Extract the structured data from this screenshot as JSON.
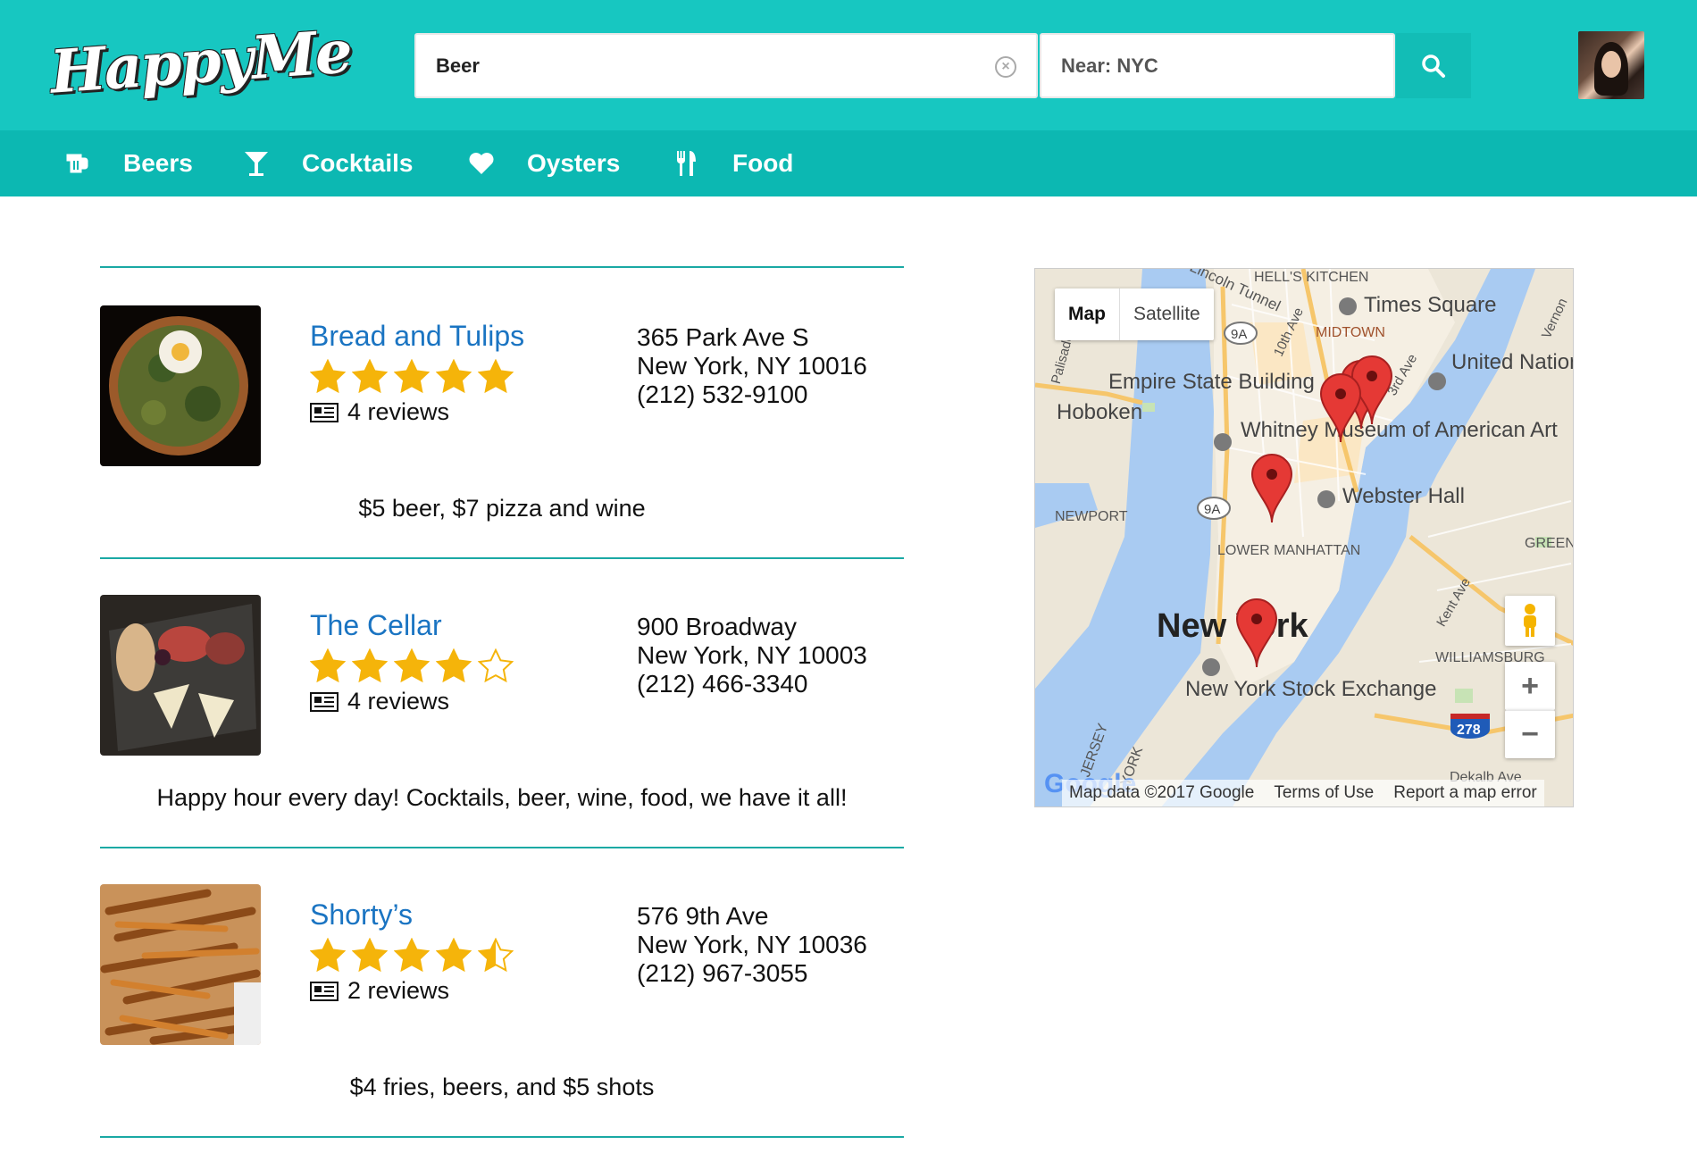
{
  "header": {
    "logo": "HappyMe",
    "search": {
      "value": "Beer"
    },
    "near": {
      "value": "Near: NYC"
    }
  },
  "nav": [
    {
      "label": "Beers",
      "icon": "beer-icon"
    },
    {
      "label": "Cocktails",
      "icon": "cocktail-icon"
    },
    {
      "label": "Oysters",
      "icon": "heart-icon"
    },
    {
      "label": "Food",
      "icon": "utensils-icon"
    }
  ],
  "results": [
    {
      "name": "Bread and Tulips",
      "rating": 5,
      "reviews": "4 reviews",
      "address1": "365 Park Ave S",
      "address2": "New York, NY 10016",
      "phone": "(212) 532-9100",
      "blurb": "$5 beer, $7 pizza and wine"
    },
    {
      "name": "The Cellar",
      "rating": 4,
      "reviews": "4 reviews",
      "address1": "900 Broadway",
      "address2": "New York, NY 10003",
      "phone": "(212) 466-3340",
      "blurb": "Happy hour every day! Cocktails, beer, wine, food, we have it all!"
    },
    {
      "name": "Shorty’s",
      "rating": 4.5,
      "reviews": "2 reviews",
      "address1": "576 9th Ave",
      "address2": "New York, NY 10036",
      "phone": "(212) 967-3055",
      "blurb": "$4 fries, beers, and $5 shots"
    }
  ],
  "map": {
    "type_buttons": [
      "Map",
      "Satellite"
    ],
    "labels": {
      "hells_kitchen": "HELL'S KITCHEN",
      "times_square": "Times Square",
      "midtown": "MIDTOWN",
      "united_nations": "United Nations Headquarters",
      "empire_state": "Empire State Building",
      "hoboken": "Hoboken",
      "whitney": "Whitney Museum of American Art",
      "webster_hall": "Webster Hall",
      "newport": "NEWPORT",
      "lower_manhattan": "LOWER MANHATTAN",
      "greenpoint": "GREEN",
      "new_york": "New York",
      "williamsburg": "WILLIAMSBURG",
      "stock_exchange": "New York Stock Exchange",
      "route_9a": "9A",
      "route_278": "278",
      "kent_ave": "Kent Ave",
      "third_ave": "3rd Ave",
      "tenth_ave": "10th Ave",
      "tunnel": "Lincoln Tunnel",
      "jersey": "JERSEY",
      "york": "YORK",
      "dekalb": "Dekalb Ave",
      "vernon": "Vernon",
      "palisade": "Palisade"
    },
    "footer": [
      "Map data ©2017 Google",
      "Terms of Use",
      "Report a map error"
    ],
    "google_logo": "Google"
  }
}
